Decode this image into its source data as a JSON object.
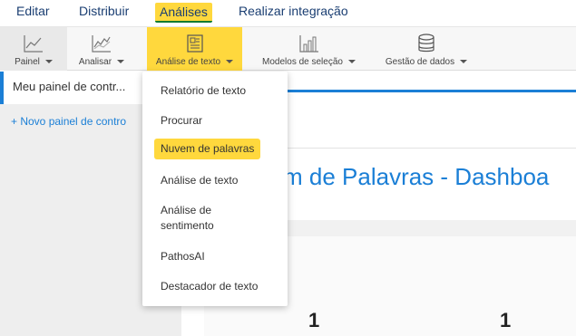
{
  "menu": {
    "items": [
      "Editar",
      "Distribuir",
      "Análises",
      "Realizar integração"
    ]
  },
  "toolbar": {
    "tools": [
      {
        "label": "Painel",
        "icon": "line-chart-icon"
      },
      {
        "label": "Analisar",
        "icon": "trend-chart-icon"
      },
      {
        "label": "Análise de texto",
        "icon": "text-document-icon"
      },
      {
        "label": "Modelos de seleção",
        "icon": "bar-chart-icon"
      },
      {
        "label": "Gestão de dados",
        "icon": "database-icon"
      }
    ]
  },
  "sidebar": {
    "current": "Meu painel de contr...",
    "new_panel": "+ Novo painel de contro"
  },
  "main": {
    "title": "m de Palavras - Dashboa",
    "kpi1": "1",
    "kpi2": "1"
  },
  "dropdown": {
    "items": [
      "Relatório de texto",
      "Procurar",
      "Nuvem de palavras",
      "Análise de texto",
      "Análise de",
      "sentimento",
      "PathosAI",
      "Destacador de texto"
    ]
  },
  "colors": {
    "accent": "#1b7fd6",
    "highlight": "#ffd83d"
  }
}
